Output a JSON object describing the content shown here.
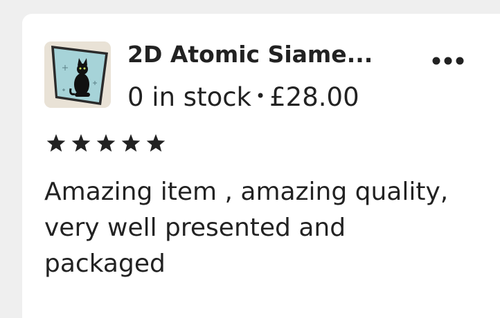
{
  "listing": {
    "title": "2D Atomic Siame...",
    "stock": "0 in stock",
    "separator": "•",
    "price": "£28.00",
    "thumbnail_icon": "black-cat-artwork",
    "more_icon": "more-horizontal-icon"
  },
  "review": {
    "rating": 5,
    "rating_max": 5,
    "star_color": "#222222",
    "text": "Amazing item , amazing quality, very well presented and packaged"
  }
}
